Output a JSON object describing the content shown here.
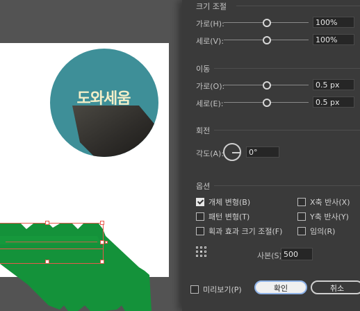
{
  "canvas": {
    "logo_text": "도와세움",
    "colors": {
      "circle": "#3e8f98",
      "shadow": "#2b2a27",
      "green": "#14923a",
      "selection": "#e8584b"
    }
  },
  "dialog": {
    "scale": {
      "title": "크기 조절",
      "horizontal_label": "가로(H):",
      "horizontal_value": "100%",
      "vertical_label": "세로(V):",
      "vertical_value": "100%"
    },
    "move": {
      "title": "이동",
      "horizontal_label": "가로(O):",
      "horizontal_value": "0.5 px",
      "vertical_label": "세로(E):",
      "vertical_value": "0.5 px"
    },
    "rotate": {
      "title": "회전",
      "angle_label": "각도(A):",
      "angle_value": "0°"
    },
    "options": {
      "title": "옵션",
      "transform_objects": {
        "label": "개체 변형(B)",
        "checked": true
      },
      "transform_patterns": {
        "label": "패턴 변형(T)",
        "checked": false
      },
      "scale_strokes": {
        "label": "획과 효과 크기 조절(F)",
        "checked": false
      },
      "reflect_x": {
        "label": "X축 반사(X)",
        "checked": false
      },
      "reflect_y": {
        "label": "Y축 반사(Y)",
        "checked": false
      },
      "random": {
        "label": "임의(R)",
        "checked": false
      }
    },
    "copies": {
      "label": "사본(S)",
      "value": "500"
    },
    "preview": {
      "label": "미리보기(P)",
      "checked": false
    },
    "ok_label": "확인",
    "cancel_label": "취소"
  }
}
